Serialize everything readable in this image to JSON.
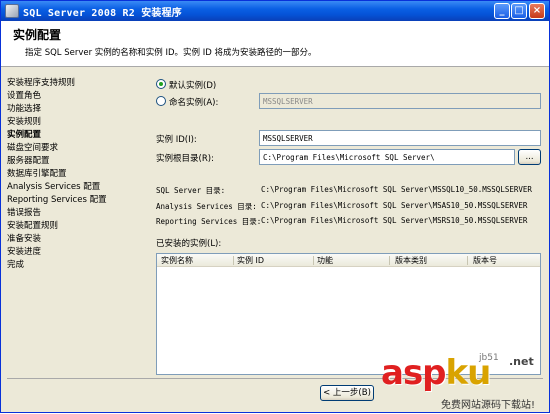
{
  "window": {
    "title": "SQL Server 2008 R2 安装程序",
    "controls": {
      "minimize": "_",
      "maximize": "□",
      "close": "×"
    }
  },
  "header": {
    "title": "实例配置",
    "subtitle": "指定 SQL Server 实例的名称和实例 ID。实例 ID 将成为安装路径的一部分。"
  },
  "nav": {
    "items": [
      {
        "label": "安装程序支持规则"
      },
      {
        "label": "设置角色"
      },
      {
        "label": "功能选择"
      },
      {
        "label": "安装规则"
      },
      {
        "label": "实例配置",
        "active": true
      },
      {
        "label": "磁盘空间要求"
      },
      {
        "label": "服务器配置"
      },
      {
        "label": "数据库引擎配置"
      },
      {
        "label": "Analysis Services 配置"
      },
      {
        "label": "Reporting Services 配置"
      },
      {
        "label": "错误报告"
      },
      {
        "label": "安装配置规则"
      },
      {
        "label": "准备安装"
      },
      {
        "label": "安装进度"
      },
      {
        "label": "完成"
      }
    ]
  },
  "form": {
    "default_instance_label": "默认实例(D)",
    "default_instance_selected": true,
    "named_instance_label": "命名实例(A):",
    "named_instance_value": "MSSQLSERVER",
    "instance_id_label": "实例 ID(I):",
    "instance_id_value": "MSSQLSERVER",
    "instance_root_label": "实例根目录(R):",
    "instance_root_value": "C:\\Program Files\\Microsoft SQL Server\\",
    "browse_label": "..."
  },
  "directories": [
    {
      "label": "SQL Server 目录:",
      "value": "C:\\Program Files\\Microsoft SQL Server\\MSSQL10_50.MSSQLSERVER"
    },
    {
      "label": "Analysis Services 目录:",
      "value": "C:\\Program Files\\Microsoft SQL Server\\MSAS10_50.MSSQLSERVER"
    },
    {
      "label": "Reporting Services 目录:",
      "value": "C:\\Program Files\\Microsoft SQL Server\\MSRS10_50.MSSQLSERVER"
    }
  ],
  "installed_instances": {
    "label": "已安装的实例(L):",
    "columns": [
      "实例名称",
      "实例 ID",
      "功能",
      "版本类别",
      "版本号"
    ]
  },
  "footer": {
    "back_label": "< 上一步(B)"
  },
  "watermark": {
    "main_left": "asp",
    "main_right": "ku",
    "suffix": ".net",
    "corner": "jb51",
    "sub": "免费网站源码下载站!"
  },
  "colors": {
    "titlebar": "#0a5fe4",
    "window_bg": "#ece9d8",
    "radio_dot": "#21a121",
    "watermark_red": "#e02020",
    "watermark_gold": "#d9a300"
  },
  "icons": [
    "app-icon",
    "minimize-icon",
    "maximize-icon",
    "close-icon"
  ]
}
